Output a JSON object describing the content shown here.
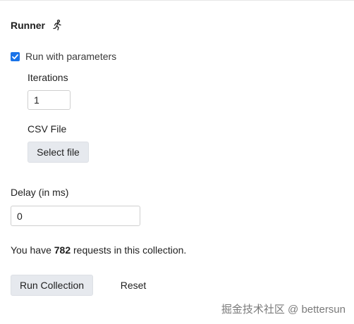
{
  "runner": {
    "title": "Runner",
    "icon": "running-person-icon"
  },
  "parameters": {
    "checkbox_label": "Run with parameters",
    "checked": true,
    "accent_color": "#1a73e8"
  },
  "iterations": {
    "label": "Iterations",
    "value": "1"
  },
  "csv": {
    "label": "CSV File",
    "button_label": "Select file"
  },
  "delay": {
    "label": "Delay (in ms)",
    "value": "0"
  },
  "info": {
    "prefix": "You have ",
    "count": "782",
    "suffix": " requests in this collection."
  },
  "actions": {
    "run_label": "Run Collection",
    "reset_label": "Reset"
  },
  "watermark": "掘金技术社区 @ bettersun"
}
